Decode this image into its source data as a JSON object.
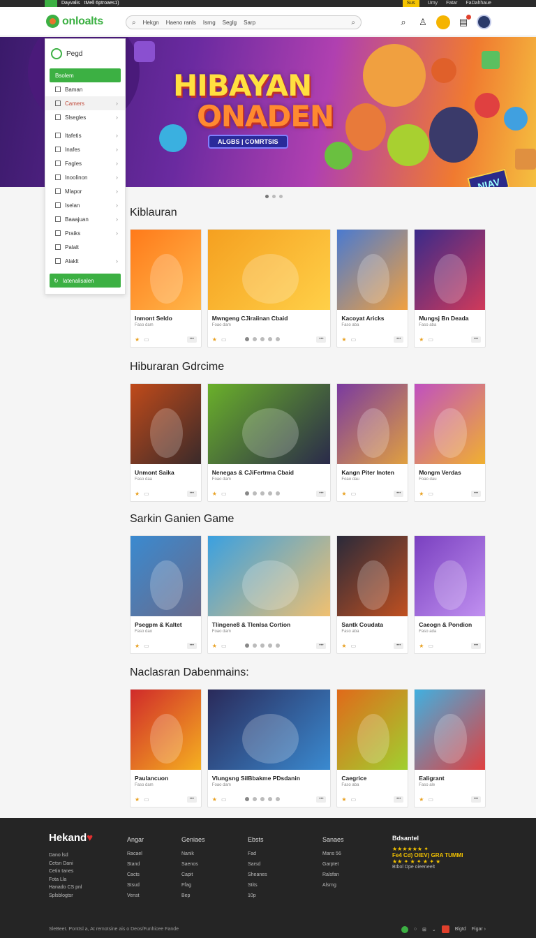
{
  "topstrip": {
    "left": "Dayvalis",
    "left2": "tMell 6ptroaes1)",
    "right": [
      "Sus",
      "Umy",
      "Fatar",
      "FaDahhaue"
    ]
  },
  "header": {
    "logo": "onloalts",
    "search_tabs": [
      "Hekgn",
      "Haeno ranls",
      "Isrng",
      "Seglg",
      "Sarp"
    ]
  },
  "side_menu": {
    "header": "Pegd",
    "items": [
      {
        "label": "Bsolem",
        "state": "active"
      },
      {
        "label": "Baman",
        "state": ""
      },
      {
        "label": "Camers",
        "state": "hl",
        "chev": "›"
      },
      {
        "label": "Slsegles",
        "state": "",
        "chev": "›"
      },
      {
        "label": "Itafetis",
        "state": "gsep",
        "chev": "›"
      },
      {
        "label": "Inafes",
        "state": "",
        "chev": "›"
      },
      {
        "label": "Fagles",
        "state": "",
        "chev": "›"
      },
      {
        "label": "Inoolinon",
        "state": "",
        "chev": "›"
      },
      {
        "label": "Mlapor",
        "state": "",
        "chev": "›"
      },
      {
        "label": "Iselan",
        "state": "",
        "chev": "›"
      },
      {
        "label": "Baaajuan",
        "state": "",
        "chev": "›"
      },
      {
        "label": "Praiks",
        "state": "",
        "chev": "›"
      },
      {
        "label": "Palalt",
        "state": "",
        "chev": ""
      },
      {
        "label": "Alaklt",
        "state": "",
        "chev": "›"
      }
    ],
    "button": "Iatenalisalen"
  },
  "hero": {
    "line1": "HIBAYAN",
    "line2": "ONADEN",
    "subtitle": "ALGBS | COMRTSIS",
    "tag": "NIAV"
  },
  "sections": [
    {
      "title": "Kiblauran",
      "cards": [
        {
          "title": "Inmont Seldo",
          "sub": "Faso dam",
          "size": "s",
          "colors": [
            "#ff7a1a",
            "#ffb74a"
          ]
        },
        {
          "title": "Mwngeng CJiraiinan Cbaid",
          "sub": "Foao dam",
          "size": "w",
          "colors": [
            "#f5a020",
            "#ffd048"
          ]
        },
        {
          "title": "Kacoyat Aricks",
          "sub": "Faso aba",
          "size": "s",
          "colors": [
            "#4a7ad0",
            "#f0a040"
          ]
        },
        {
          "title": "Mungsj Bn Deada",
          "sub": "Faso aba",
          "size": "s",
          "colors": [
            "#3a2a8a",
            "#d03a5a"
          ]
        }
      ]
    },
    {
      "title": "Hiburaran Gdrcime",
      "cards": [
        {
          "title": "Unmont Saika",
          "sub": "Faso daa",
          "size": "s",
          "colors": [
            "#c04a1a",
            "#3a2a2a"
          ]
        },
        {
          "title": "Nenegas & CJiFertrma Cbaid",
          "sub": "Foao dam",
          "size": "w",
          "colors": [
            "#6ab02a",
            "#2a2a4a"
          ]
        },
        {
          "title": "Kangn Piter Inoten",
          "sub": "Foao dau",
          "size": "s",
          "colors": [
            "#7a3aa0",
            "#e0a040"
          ]
        },
        {
          "title": "Mongm Verdas",
          "sub": "Foao dau",
          "size": "s",
          "colors": [
            "#c050c0",
            "#f0b030"
          ]
        }
      ]
    },
    {
      "title": "Sarkin Ganien Game",
      "cards": [
        {
          "title": "Psegpm & Kaltet",
          "sub": "Faso dao",
          "size": "s",
          "colors": [
            "#3a8ad0",
            "#6a6a8a"
          ]
        },
        {
          "title": "Tlingene8 & Tlenlsa Cortion",
          "sub": "Foao dam",
          "size": "w",
          "colors": [
            "#3aa0e0",
            "#f0c070"
          ]
        },
        {
          "title": "Santk Coudata",
          "sub": "Faso aba",
          "size": "s",
          "colors": [
            "#2a2a3a",
            "#c05020"
          ]
        },
        {
          "title": "Caeogn & Pondion",
          "sub": "Faso ada",
          "size": "s",
          "colors": [
            "#7a40c0",
            "#c090f0"
          ]
        }
      ]
    },
    {
      "title": "Naclasran Dabenmains:",
      "cards": [
        {
          "title": "Paulancuon",
          "sub": "Faso dam",
          "size": "s",
          "colors": [
            "#d02a2a",
            "#f5b020"
          ]
        },
        {
          "title": "Vlungsng SilBbakme PDsdanin",
          "sub": "Foao dam",
          "size": "w",
          "colors": [
            "#2a2a5a",
            "#3a8ad0"
          ]
        },
        {
          "title": "Caegrice",
          "sub": "Faso aba",
          "size": "s",
          "colors": [
            "#e06a1a",
            "#a0d030"
          ]
        },
        {
          "title": "Ealigrant",
          "sub": "Faso ale",
          "size": "s",
          "colors": [
            "#40b0e0",
            "#e04040"
          ]
        }
      ]
    }
  ],
  "footer": {
    "brand": "Hekand",
    "brand_lines": [
      "Dano lsd",
      "Cetsn Dani",
      "Cetin tanes",
      "Fota Lla",
      "Hanado CS pnl",
      "Splsblogtsr"
    ],
    "columns": [
      {
        "heading": "Angar",
        "items": [
          "Racael",
          "Stand",
          "Cacts",
          "Stsud",
          "Venst"
        ]
      },
      {
        "heading": "Geniaes",
        "items": [
          "Nanik",
          "Saenos",
          "Capit",
          "Ffag",
          "Bep"
        ]
      },
      {
        "heading": "Ebsts",
        "items": [
          "Fad",
          "Sarsd",
          "Sheanes",
          "Stits",
          "10p"
        ]
      },
      {
        "heading": "Sanaes",
        "items": [
          "Mans 56",
          "Garptet",
          "Ralsfan",
          "Alsrng"
        ]
      }
    ],
    "rating": {
      "heading": "Bdsantel",
      "stars": "★★★★★★ ✦",
      "line2": "Fe4 Cd) OIEV) GRA  TUMMI",
      "stars2": "★★ ✦ ★ ✦ ★ ✦ ★",
      "line3": "Btbol Dpe oieeneelt"
    },
    "copyright": "SleBeet. Ponttsl a, At remotsine ais o Deos/Funhicee Fande",
    "bottom_right": [
      "Blgtd",
      "Figar ›"
    ]
  }
}
